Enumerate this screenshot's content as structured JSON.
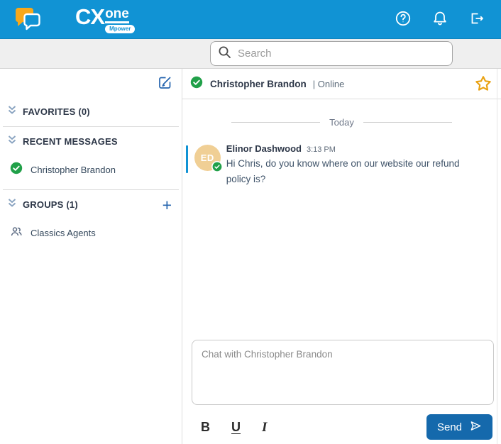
{
  "topbar": {
    "logo_cx": "CX",
    "logo_one": "one",
    "logo_badge": "Mpower"
  },
  "search": {
    "placeholder": "Search"
  },
  "sidebar": {
    "favorites_label": "FAVORITES (0)",
    "recent_label": "RECENT MESSAGES",
    "groups_label": "GROUPS (1)",
    "add_group_label": "+",
    "contacts": [
      {
        "name": "Christopher Brandon",
        "status": "online"
      }
    ],
    "groups": [
      {
        "name": "Classics Agents"
      }
    ]
  },
  "chat": {
    "contact_name": "Christopher Brandon",
    "status_text": "| Online",
    "day_divider": "Today",
    "message": {
      "sender": "Elinor Dashwood",
      "time": "3:13 PM",
      "initials": "ED",
      "text": "Hi Chris, do you know where on our website our refund policy is?"
    },
    "composer": {
      "placeholder": "Chat with Christopher Brandon",
      "bold": "B",
      "underline": "U",
      "italic": "I",
      "send": "Send"
    }
  },
  "colors": {
    "topbar_blue": "#1193d4",
    "logo_orange": "#f7a81b",
    "send_blue": "#1569ac",
    "star_gold": "#e9a213",
    "online_green": "#21a049",
    "avatar_tan": "#f0cf95",
    "message_accent": "#1193d4",
    "icon_blue": "#2464ae"
  }
}
